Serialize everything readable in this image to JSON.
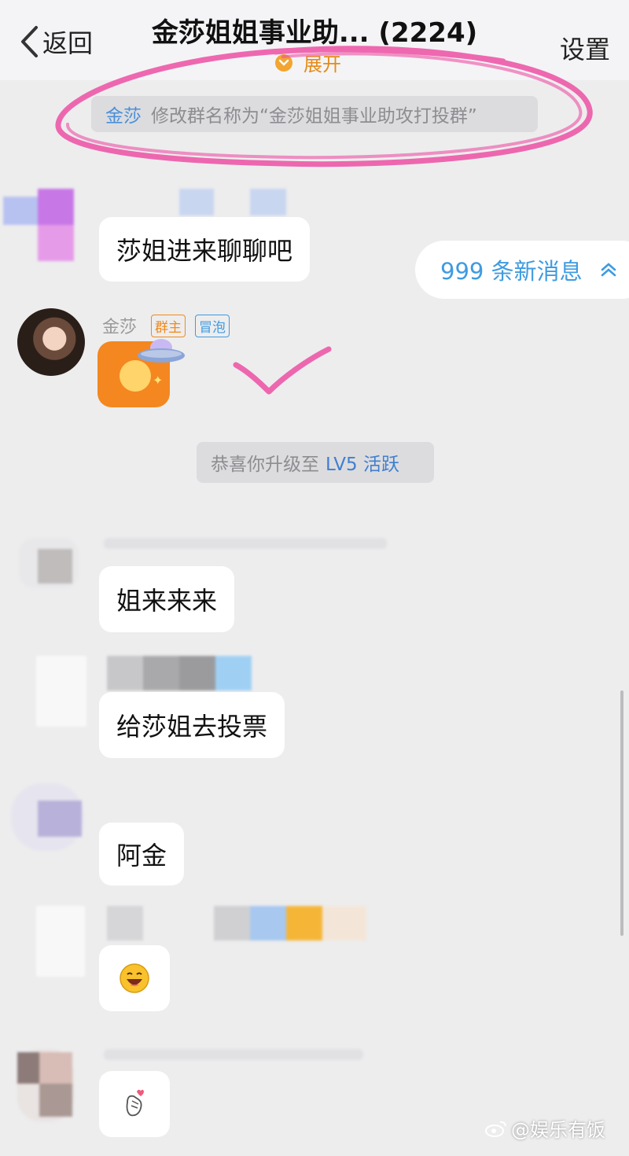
{
  "header": {
    "back_label": "返回",
    "title": "金莎姐姐事业助... (2224)",
    "expand_label": "展开",
    "settings_label": "设置"
  },
  "system": {
    "rename_user": "金莎",
    "rename_text": "修改群名称为“金莎姐姐事业助攻打投群”",
    "levelup_prefix": "恭喜你升级至",
    "levelup_level": "LV5 活跃"
  },
  "new_messages": {
    "label": "999 条新消息"
  },
  "sender": {
    "name": "金莎",
    "badge_owner": "群主",
    "badge_bubble": "冒泡"
  },
  "messages": [
    {
      "text": "莎姐进来聊聊吧"
    },
    {
      "text": "姐来来来"
    },
    {
      "text": "给莎姐去投票"
    },
    {
      "text": "阿金"
    }
  ],
  "watermark": "@娱乐有饭",
  "colors": {
    "accent_blue": "#3f9be0",
    "orange": "#f08a1c",
    "highlight_pink": "#ec4fa3"
  }
}
